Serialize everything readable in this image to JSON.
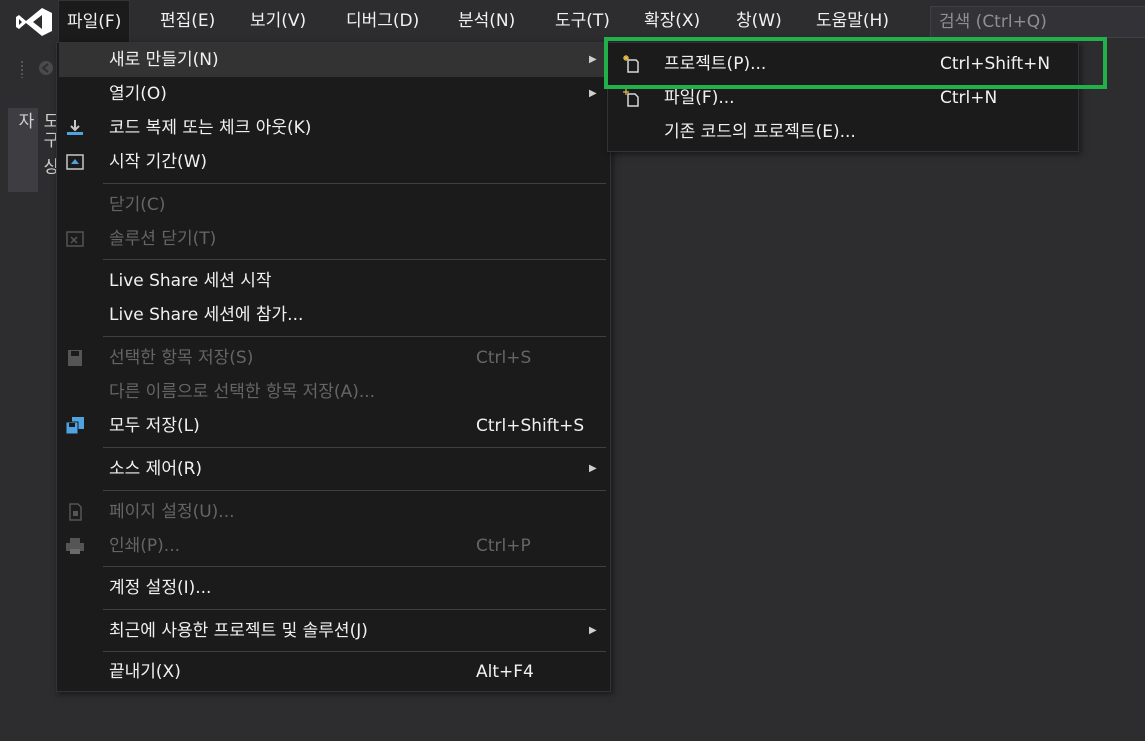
{
  "menubar": {
    "items": [
      {
        "label": "파일(F)"
      },
      {
        "label": "편집(E)"
      },
      {
        "label": "보기(V)"
      },
      {
        "label": "디버그(D)"
      },
      {
        "label": "분석(N)"
      },
      {
        "label": "도구(T)"
      },
      {
        "label": "확장(X)"
      },
      {
        "label": "창(W)"
      },
      {
        "label": "도움말(H)"
      }
    ],
    "search_placeholder": "검색 (Ctrl+Q)"
  },
  "toolbox_tab": {
    "label": "도구 상자"
  },
  "file_menu": {
    "items": [
      {
        "label": "새로 만들기(N)",
        "shortcut": ""
      },
      {
        "label": "열기(O)",
        "shortcut": ""
      },
      {
        "label": "코드 복제 또는 체크 아웃(K)",
        "shortcut": ""
      },
      {
        "label": "시작 기간(W)",
        "shortcut": ""
      },
      {
        "label": "닫기(C)",
        "shortcut": ""
      },
      {
        "label": "솔루션 닫기(T)",
        "shortcut": ""
      },
      {
        "label": "Live Share 세션 시작",
        "shortcut": ""
      },
      {
        "label": "Live Share 세션에 참가...",
        "shortcut": ""
      },
      {
        "label": "선택한 항목 저장(S)",
        "shortcut": "Ctrl+S"
      },
      {
        "label": "다른 이름으로 선택한 항목 저장(A)...",
        "shortcut": ""
      },
      {
        "label": "모두 저장(L)",
        "shortcut": "Ctrl+Shift+S"
      },
      {
        "label": "소스 제어(R)",
        "shortcut": ""
      },
      {
        "label": "페이지 설정(U)...",
        "shortcut": ""
      },
      {
        "label": "인쇄(P)...",
        "shortcut": "Ctrl+P"
      },
      {
        "label": "계정 설정(I)...",
        "shortcut": ""
      },
      {
        "label": "최근에 사용한 프로젝트 및 솔루션(J)",
        "shortcut": ""
      },
      {
        "label": "끝내기(X)",
        "shortcut": "Alt+F4"
      }
    ]
  },
  "new_submenu": {
    "items": [
      {
        "label": "프로젝트(P)...",
        "shortcut": "Ctrl+Shift+N"
      },
      {
        "label": "파일(F)...",
        "shortcut": "Ctrl+N"
      },
      {
        "label": "기존 코드의 프로젝트(E)...",
        "shortcut": ""
      }
    ]
  },
  "colors": {
    "background": "#2d2d30",
    "menu_background": "#1b1b1c",
    "disabled_text": "#656565",
    "highlight": "#22b04b",
    "vs_purple": "#ffffff"
  }
}
